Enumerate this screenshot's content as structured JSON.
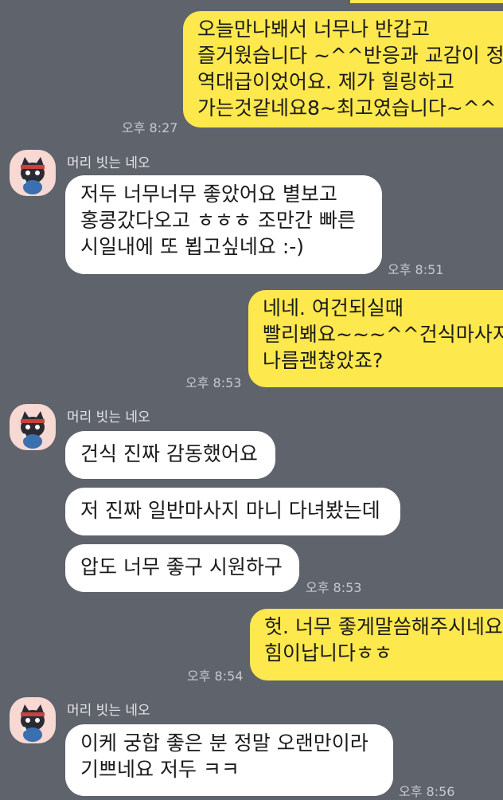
{
  "colors": {
    "background": "#5f636b",
    "my_bubble": "#fde84d",
    "their_bubble": "#ffffff",
    "avatar_bg": "#f7d8d2"
  },
  "sender": {
    "name": "머리 빗는 네오",
    "avatar_icon": "cat-character-avatar-icon"
  },
  "messages": [
    {
      "side": "mine",
      "text": "오늘만나봬서 너무나 반갑고\n즐거웠습니다 ~^^반응과 교감이 정말\n역대급이었어요. 제가 힐링하고\n가는것같네요8~최고였습니다~^^",
      "time": "오후 8:27"
    },
    {
      "side": "theirs",
      "text": "저두 너무너무 좋았어요 별보고\n홍콩갔다오고 ㅎㅎㅎ 조만간 빠른\n시일내에 또 뵙고싶네요 :-)",
      "time": "오후 8:51"
    },
    {
      "side": "mine",
      "text": "네네. 여건되실때\n빨리봬요~~~^^건식마사지도\n나름괜찮았죠?",
      "time": "오후 8:53"
    },
    {
      "side": "theirs",
      "text": "건식 진짜 감동했어요"
    },
    {
      "side": "theirs",
      "text": "저 진짜 일반마사지 마니 다녀봤는데"
    },
    {
      "side": "theirs",
      "text": "압도 너무 좋구 시원하구",
      "time": "오후 8:53"
    },
    {
      "side": "mine",
      "text": "헛. 너무 좋게말씀해주시네요\n힘이납니다ㅎㅎ",
      "time": "오후 8:54"
    },
    {
      "side": "theirs",
      "text": "이케 궁합 좋은 분 정말 오랜만이라\n기쁘네요 저두 ㅋㅋ",
      "time": "오후 8:56"
    }
  ]
}
